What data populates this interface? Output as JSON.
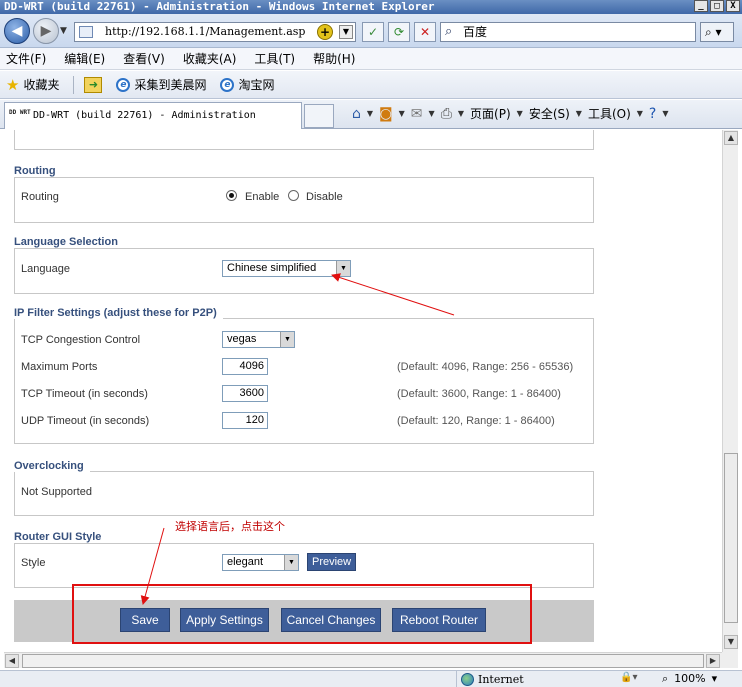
{
  "window": {
    "title": "DD-WRT (build 22761) - Administration - Windows Internet Explorer",
    "controls": {
      "minimize": "_",
      "maximize": "□",
      "close": "X"
    }
  },
  "address_bar": {
    "url": "http://192.168.1.1/Management.asp",
    "search_placeholder": "百度"
  },
  "menu": [
    "文件(F)",
    "编辑(E)",
    "查看(V)",
    "收藏夹(A)",
    "工具(T)",
    "帮助(H)"
  ],
  "favorites_bar": {
    "favorites_label": "收藏夹",
    "links": [
      "采集到美晨网",
      "淘宝网"
    ]
  },
  "tab": {
    "logo_text": "DD WRT",
    "title": "DD-WRT (build 22761) - Administration"
  },
  "command_bar": {
    "page": "页面(P)",
    "safety": "安全(S)",
    "tools": "工具(O)"
  },
  "sections": {
    "routing": {
      "legend": "Routing",
      "label": "Routing",
      "options": [
        "Enable",
        "Disable"
      ],
      "selected": "Enable"
    },
    "language": {
      "legend": "Language Selection",
      "label": "Language",
      "value": "Chinese simplified"
    },
    "ip_filter": {
      "legend": "IP Filter Settings (adjust these for P2P)",
      "congestion_label": "TCP Congestion Control",
      "congestion_value": "vegas",
      "max_ports_label": "Maximum Ports",
      "max_ports_value": "4096",
      "max_ports_hint": "(Default: 4096, Range: 256 - 65536)",
      "tcp_timeout_label": "TCP Timeout (in seconds)",
      "tcp_timeout_value": "3600",
      "tcp_timeout_hint": "(Default: 3600, Range: 1 - 86400)",
      "udp_timeout_label": "UDP Timeout (in seconds)",
      "udp_timeout_value": "120",
      "udp_timeout_hint": "(Default: 120, Range: 1 - 86400)"
    },
    "overclocking": {
      "legend": "Overclocking",
      "text": "Not Supported"
    },
    "gui_style": {
      "legend": "Router GUI Style",
      "label": "Style",
      "value": "elegant",
      "preview_label": "Preview"
    }
  },
  "buttons": {
    "save": "Save",
    "apply": "Apply Settings",
    "cancel": "Cancel Changes",
    "reboot": "Reboot Router"
  },
  "annotation": {
    "note": "选择语言后，点击这个",
    "color": "#e01010"
  },
  "status_bar": {
    "zone": "Internet",
    "zoom": "100%"
  }
}
